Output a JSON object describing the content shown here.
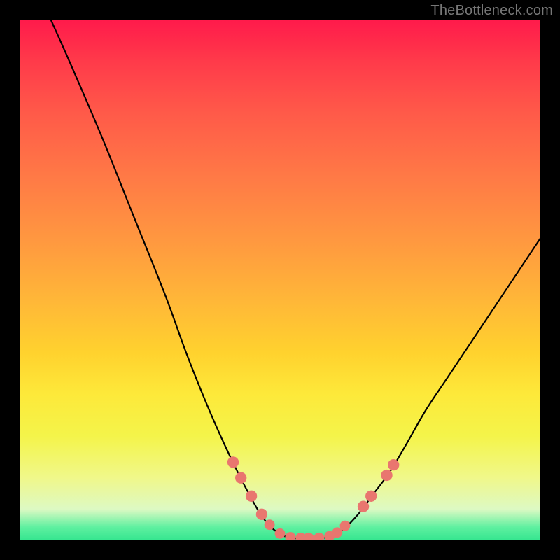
{
  "watermark": "TheBottleneck.com",
  "colors": {
    "curve_stroke": "#000000",
    "marker_fill": "#e9766f",
    "marker_stroke": "#e9766f",
    "frame_bg": "#000000"
  },
  "chart_data": {
    "type": "line",
    "title": "",
    "xlabel": "",
    "ylabel": "",
    "xlim": [
      0,
      100
    ],
    "ylim": [
      0,
      100
    ],
    "grid": false,
    "legend": false,
    "curve": [
      {
        "x": 6,
        "y": 100
      },
      {
        "x": 10,
        "y": 91
      },
      {
        "x": 16,
        "y": 77
      },
      {
        "x": 22,
        "y": 62
      },
      {
        "x": 28,
        "y": 47
      },
      {
        "x": 32,
        "y": 36
      },
      {
        "x": 36,
        "y": 26
      },
      {
        "x": 40,
        "y": 17
      },
      {
        "x": 44,
        "y": 9
      },
      {
        "x": 47,
        "y": 4
      },
      {
        "x": 50,
        "y": 1.2
      },
      {
        "x": 53,
        "y": 0.4
      },
      {
        "x": 56,
        "y": 0.4
      },
      {
        "x": 59,
        "y": 0.6
      },
      {
        "x": 62,
        "y": 2
      },
      {
        "x": 65,
        "y": 5
      },
      {
        "x": 68,
        "y": 9
      },
      {
        "x": 71,
        "y": 13
      },
      {
        "x": 74,
        "y": 18
      },
      {
        "x": 78,
        "y": 25
      },
      {
        "x": 82,
        "y": 31
      },
      {
        "x": 86,
        "y": 37
      },
      {
        "x": 90,
        "y": 43
      },
      {
        "x": 94,
        "y": 49
      },
      {
        "x": 98,
        "y": 55
      },
      {
        "x": 100,
        "y": 58
      }
    ],
    "markers": [
      {
        "x": 41.0,
        "y": 15.0,
        "r": 1.1
      },
      {
        "x": 42.5,
        "y": 12.0,
        "r": 1.1
      },
      {
        "x": 44.5,
        "y": 8.5,
        "r": 1.1
      },
      {
        "x": 46.5,
        "y": 5.0,
        "r": 1.1
      },
      {
        "x": 48.0,
        "y": 3.0,
        "r": 1.0
      },
      {
        "x": 50.0,
        "y": 1.3,
        "r": 1.0
      },
      {
        "x": 52.0,
        "y": 0.6,
        "r": 1.0
      },
      {
        "x": 54.0,
        "y": 0.5,
        "r": 1.0
      },
      {
        "x": 55.5,
        "y": 0.5,
        "r": 1.0
      },
      {
        "x": 57.5,
        "y": 0.5,
        "r": 1.0
      },
      {
        "x": 59.5,
        "y": 0.8,
        "r": 1.0
      },
      {
        "x": 61.0,
        "y": 1.5,
        "r": 1.0
      },
      {
        "x": 62.5,
        "y": 2.8,
        "r": 1.0
      },
      {
        "x": 66.0,
        "y": 6.5,
        "r": 1.1
      },
      {
        "x": 67.5,
        "y": 8.5,
        "r": 1.1
      },
      {
        "x": 70.5,
        "y": 12.5,
        "r": 1.1
      },
      {
        "x": 71.8,
        "y": 14.5,
        "r": 1.1
      }
    ]
  }
}
